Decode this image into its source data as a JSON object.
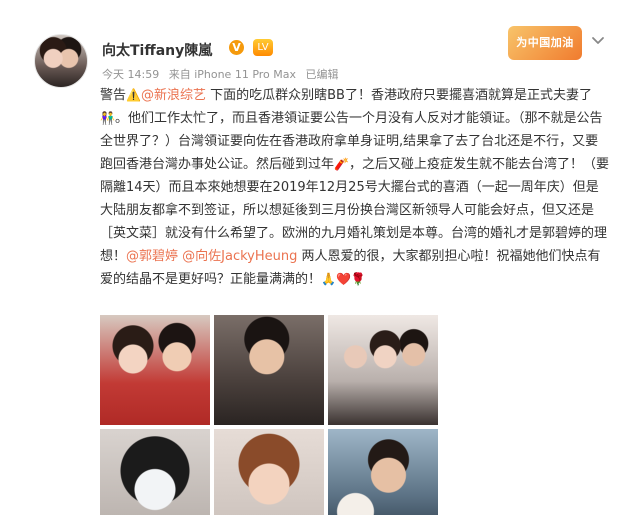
{
  "post": {
    "author": {
      "name": "向太Tiffany陳嵐",
      "vip_badge": "V",
      "level_icon": "LV"
    },
    "meta": {
      "time": "今天 14:59",
      "source": "来自 iPhone 11 Pro Max",
      "edited": "已编辑"
    },
    "promo_badge": "为中国加油",
    "text": {
      "seg1": "警告",
      "warning_icon": "⚠️",
      "mention1": "@新浪综艺",
      "seg2": " 下面的吃瓜群众别瞎BB了！香港政府只要擺喜酒就算是正式夫妻了",
      "couple_icon": "👫",
      "seg3": "。他们工作太忙了，而且香港領证要公告一个月没有人反对才能領证。（那不就是公告全世界了？）台灣領证要向佐在香港政府拿单身证明,结果拿了去了台北还是不行，又要跑回香港台灣办事处公证。然后碰到过年",
      "firecracker_icon": "🧨",
      "seg4": "，之后又碰上疫症发生就不能去台湾了！（要隔離14天）而且本來她想要在2019年12月25号大擺台式的喜酒（一起一周年庆）但是大陆朋友都拿不到签证，所以想延後到三月份换台灣区新领导人可能会好点，但又还是［英文菜］就没有什么希望了。欧洲的九月婚礼策划是本尊。台湾的婚礼才是郭碧婷的理想！",
      "mention2": "@郭碧婷",
      "mention3": "@向佐JackyHeung",
      "seg5": " 两人恩爱的很，大家都别担心啦！祝福她他们快点有爱的结晶不是更好吗？正能量满满的！",
      "end_icons": "🙏❤️🌹"
    }
  },
  "icons": {
    "menu": "chevron-down-icon"
  },
  "colors": {
    "link": "#eb7350",
    "meta": "#939393",
    "text": "#333333"
  }
}
